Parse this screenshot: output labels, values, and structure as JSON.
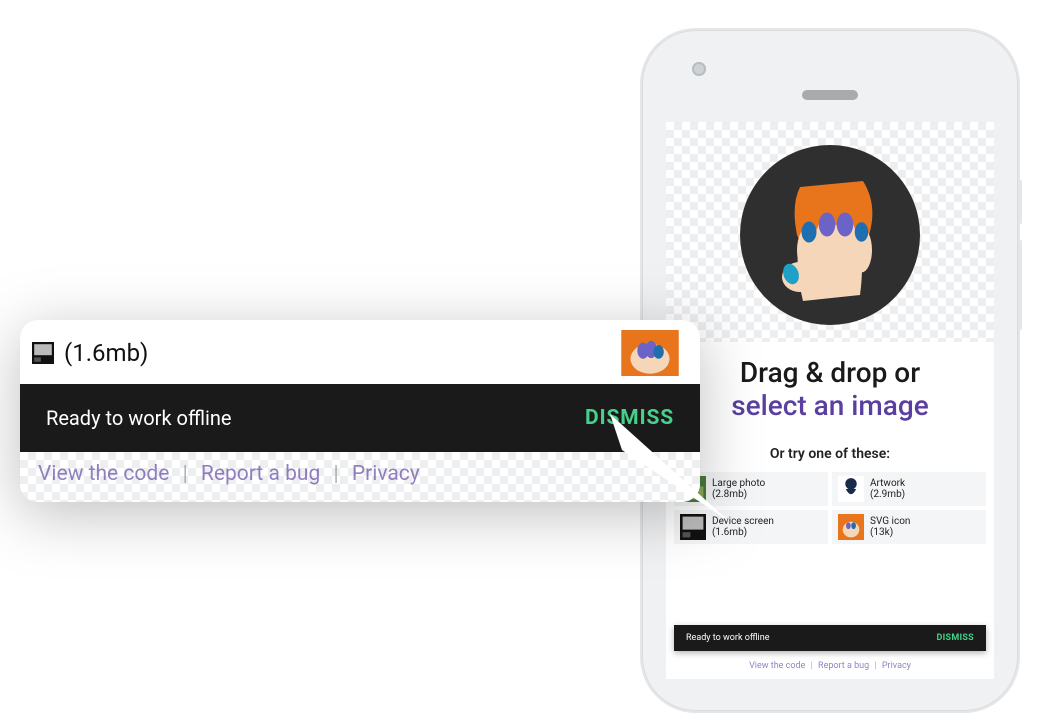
{
  "headline": {
    "line1": "Drag & drop or",
    "line2_link": "select an image"
  },
  "subhead": "Or try one of these:",
  "samples": [
    {
      "label": "Large photo",
      "size": "(2.8mb)",
      "icon": "photo"
    },
    {
      "label": "Artwork",
      "size": "(2.9mb)",
      "icon": "artwork"
    },
    {
      "label": "Device screen",
      "size": "(1.6mb)",
      "icon": "device"
    },
    {
      "label": "SVG icon",
      "size": "(13k)",
      "icon": "logo"
    }
  ],
  "toast": {
    "message": "Ready to work offline",
    "action": "DISMISS"
  },
  "footer": {
    "view_code": "View the code",
    "report_bug": "Report a bug",
    "privacy": "Privacy"
  },
  "callout": {
    "sample_size_fragment": "(1.6mb)",
    "toast_message": "Ready to work offline",
    "toast_action": "DISMISS",
    "footer_view_code": "View the code",
    "footer_report_bug": "Report a bug",
    "footer_privacy": "Privacy"
  }
}
